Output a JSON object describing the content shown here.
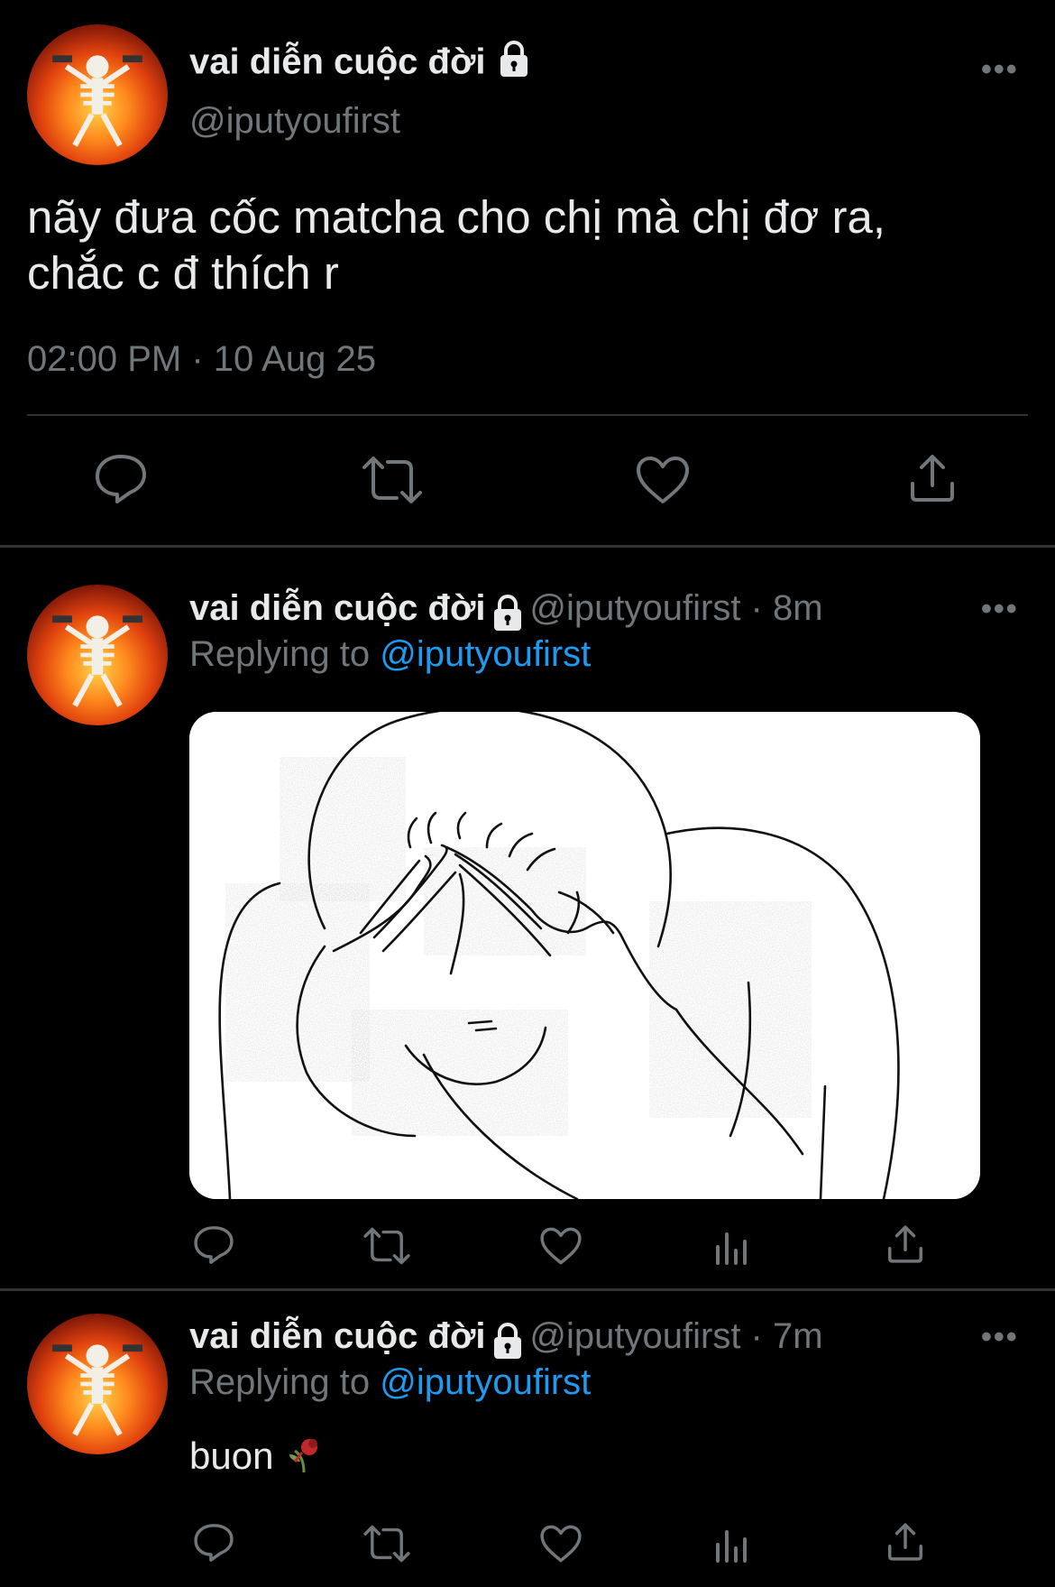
{
  "main_tweet": {
    "display_name": "vai diễn cuộc đời",
    "handle": "@iputyoufirst",
    "text_line1": "nãy đưa cốc matcha cho chị mà chị đơ ra,",
    "text_line2": "chắc c đ thích r",
    "timestamp": "02:00 PM · 10 Aug 25",
    "more_label": "•••"
  },
  "reply1": {
    "display_name": "vai diễn cuộc đời",
    "handle_time": "@iputyoufirst · 8m",
    "replying_prefix": "Replying to ",
    "replying_handle": "@iputyoufirst",
    "more_label": "•••",
    "media_icon": "crying-wojak-illustration"
  },
  "reply2": {
    "display_name": "vai diễn cuộc đời",
    "handle_time": "@iputyoufirst · 7m",
    "replying_prefix": "Replying to ",
    "replying_handle": "@iputyoufirst",
    "text": "buon",
    "emoji_icon": "wilted-flower-icon",
    "more_label": "•••"
  },
  "colors": {
    "background": "#000000",
    "text": "#e7e9ea",
    "muted": "#71767b",
    "link": "#1d9bf0",
    "divider": "#2f3336"
  }
}
